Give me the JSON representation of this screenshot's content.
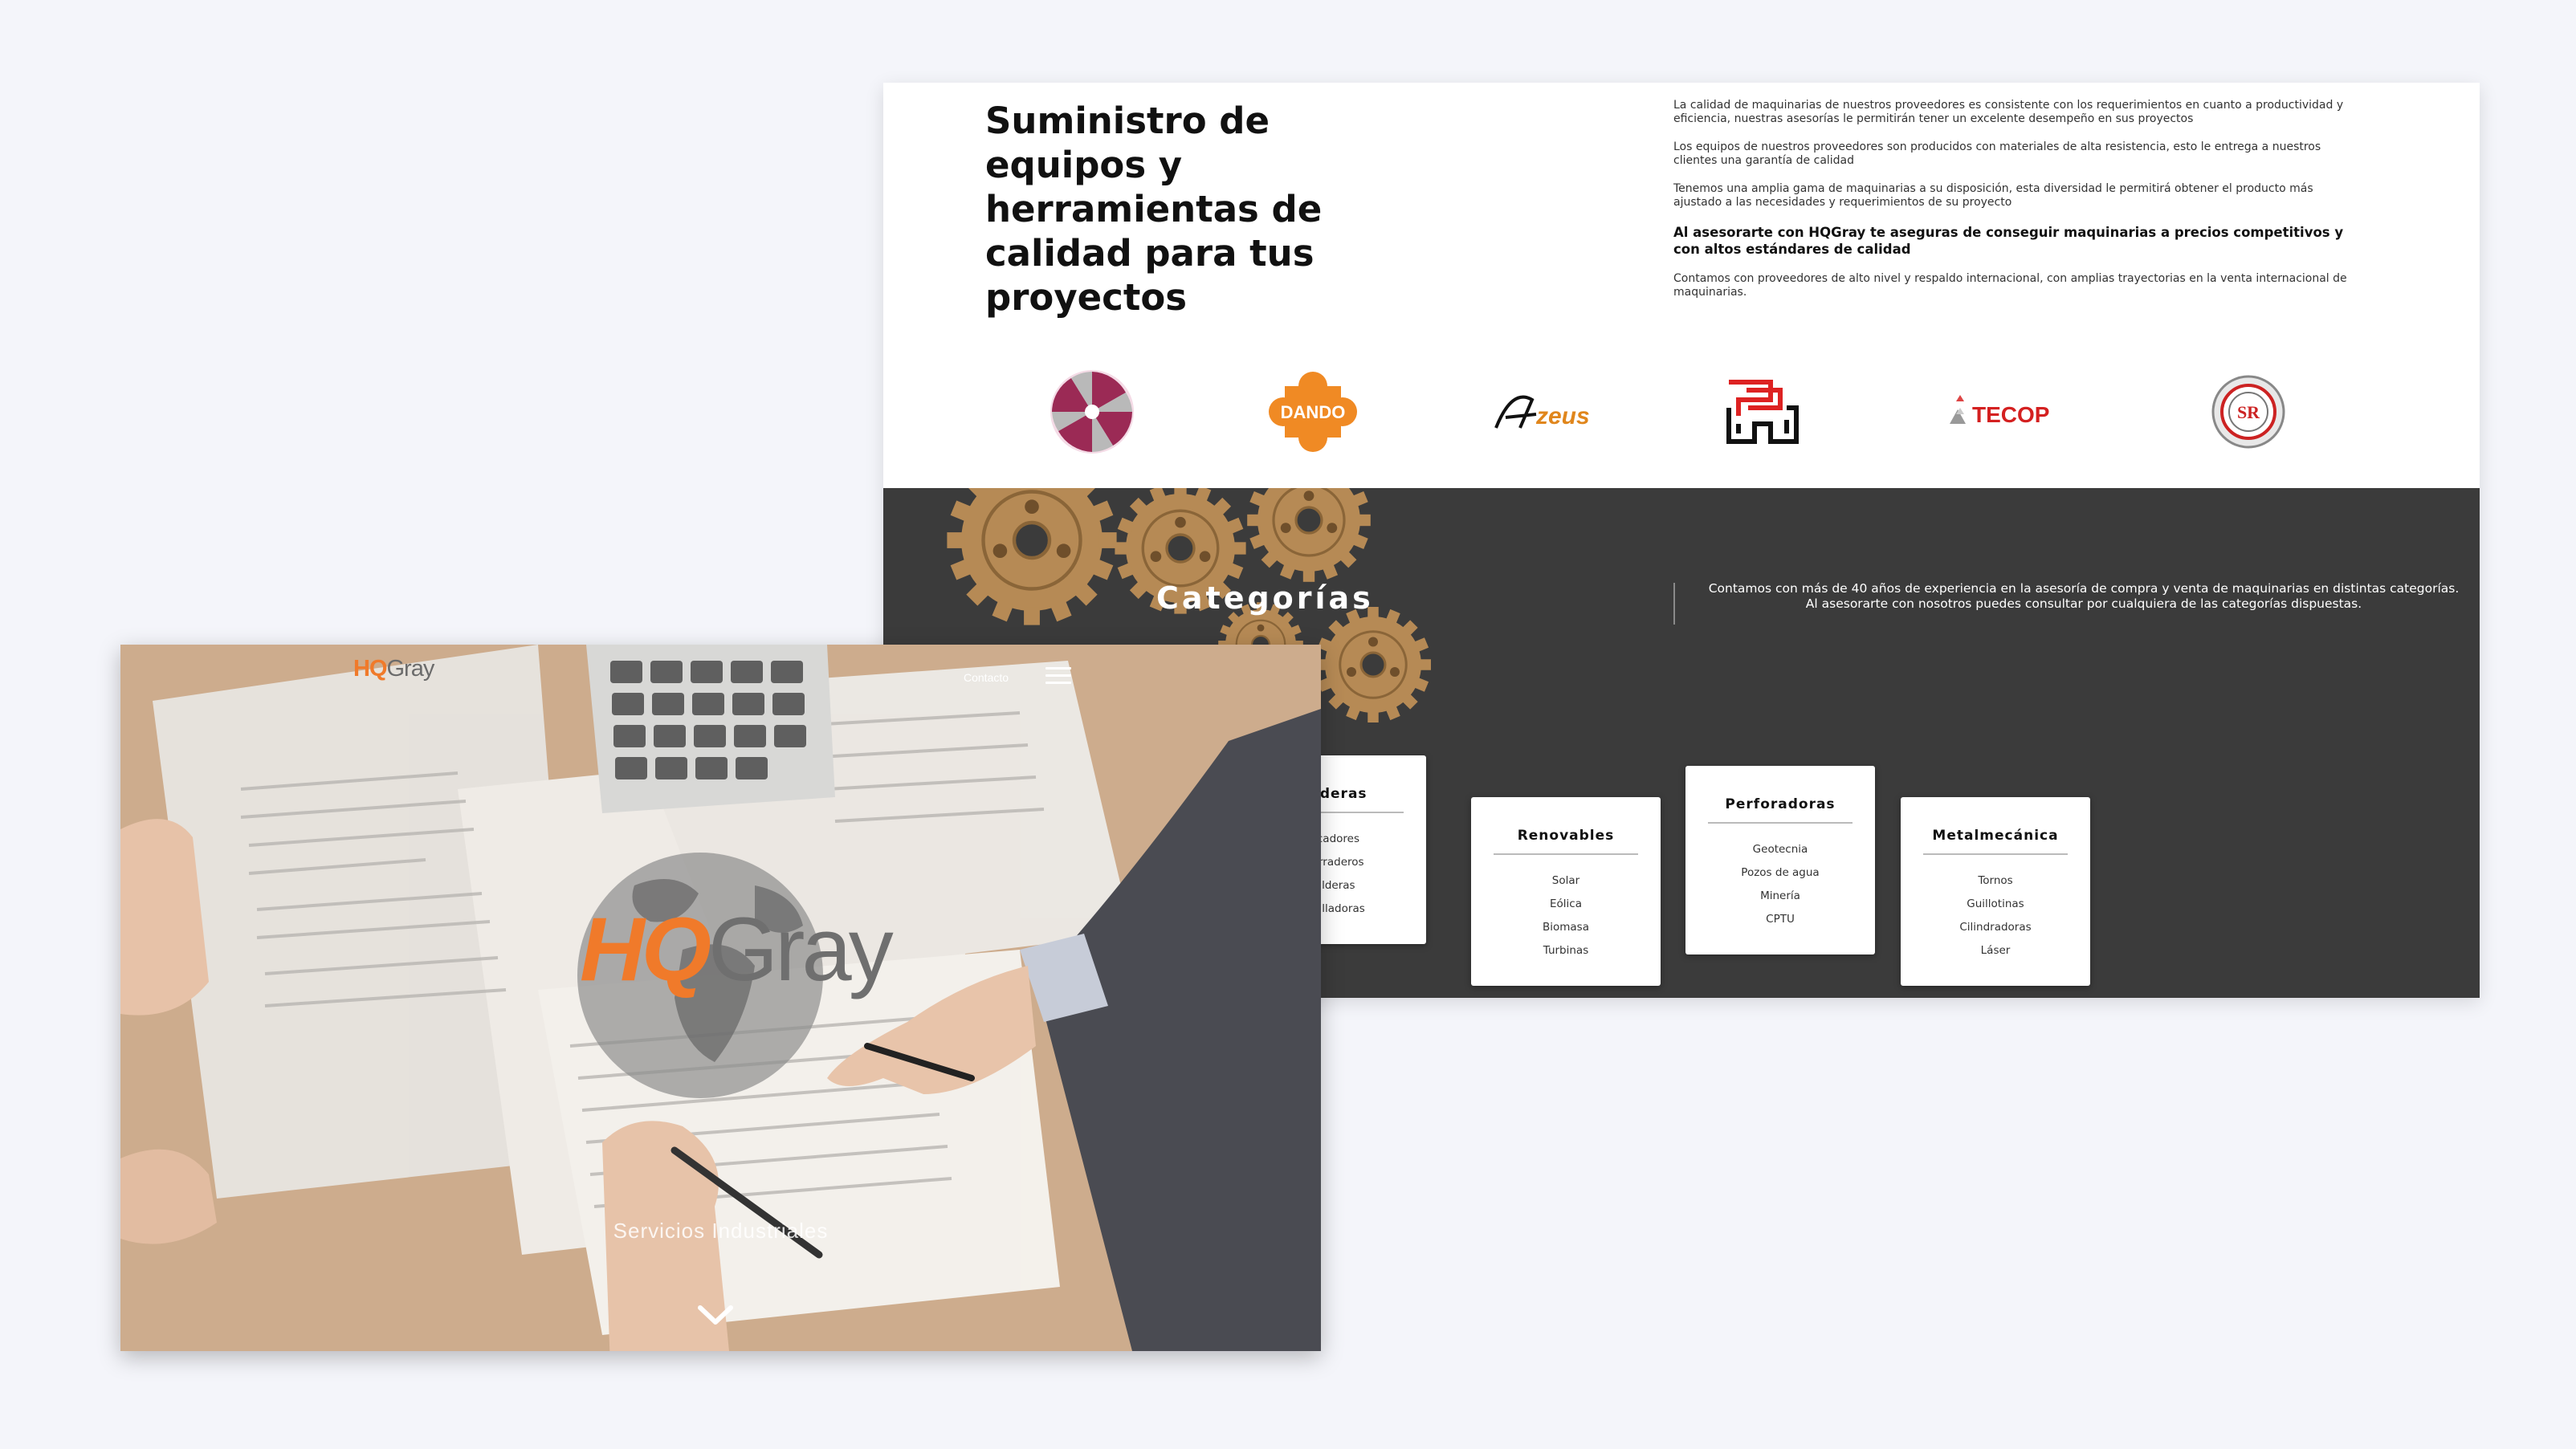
{
  "colors": {
    "page_background": "#f4f5fa",
    "brand_orange": "#f07a2a",
    "brand_gray": "#777777",
    "dark_section": "#3b3b3b"
  },
  "section_intro": {
    "heading": "Suministro de equipos y herramientas de calidad para tus proyectos",
    "paragraphs": [
      "La calidad de maquinarias de nuestros proveedores es consistente con los requerimientos en cuanto a productividad y eficiencia, nuestras asesorías le permitirán tener un excelente desempeño en sus proyectos",
      "Los equipos de nuestros proveedores son producidos con materiales de alta resistencia, esto le entrega a nuestros clientes una garantía de calidad",
      "Tenemos una amplia gama de maquinarias a su disposición, esta diversidad le permitirá obtener el producto más ajustado a las necesidades y requerimientos de su proyecto"
    ],
    "highlight": "Al asesorarte con HQGray te aseguras de conseguir maquinarias a precios competitivos y con altos estándares de calidad",
    "closing": "Contamos con proveedores de alto nivel y respaldo internacional, con amplias trayectorias en la venta internacional de maquinarias."
  },
  "partner_logos": {
    "dando": "DANDO",
    "zeus": "zeus",
    "tecop": "TECOP",
    "round_seal": "SR"
  },
  "categories": {
    "title": "Categorías",
    "description_line1": "Contamos con más de 40 años de experiencia en la asesoría de compra y venta de maquinarias en distintas categorías.",
    "description_line2": "Al asesorarte con nosotros puedes consultar por cualquiera de las categorías dispuestas.",
    "cards": [
      {
        "title": "Maderas",
        "items": [
          "Secadores",
          "Aserraderos",
          "Calderas",
          "Cepilladoras"
        ]
      },
      {
        "title": "Renovables",
        "items": [
          "Solar",
          "Eólica",
          "Biomasa",
          "Turbinas"
        ]
      },
      {
        "title": "Perforadoras",
        "items": [
          "Geotecnia",
          "Pozos de agua",
          "Minería",
          "CPTU"
        ]
      },
      {
        "title": "Metalmecánica",
        "items": [
          "Tornos",
          "Guillotinas",
          "Cilindradoras",
          "Láser"
        ]
      }
    ]
  },
  "hero": {
    "logo_hq": "HQ",
    "logo_gray": "Gray",
    "nav_contact": "Contacto",
    "big_logo_hq": "HQ",
    "big_logo_gray": "Gray",
    "subtitle": "Servicios Industriales",
    "icons": {
      "menu": "hamburger-menu-icon",
      "scroll": "chevron-down-icon"
    }
  }
}
